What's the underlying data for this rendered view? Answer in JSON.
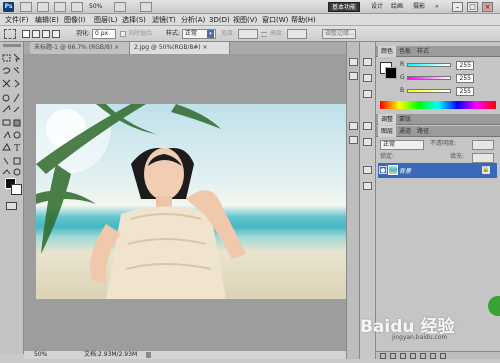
{
  "app": {
    "logo": "Ps",
    "zoom": "50%"
  },
  "workspace": {
    "active": "基本功能",
    "items": [
      "设计",
      "绘画",
      "摄影"
    ],
    "more": "»"
  },
  "window_buttons": [
    "–",
    "□",
    "×"
  ],
  "menu": [
    "文件(F)",
    "编辑(E)",
    "图像(I)",
    "图层(L)",
    "选择(S)",
    "滤镜(T)",
    "分析(A)",
    "3D(D)",
    "视图(V)",
    "窗口(W)",
    "帮助(H)"
  ],
  "options": {
    "feather_label": "羽化:",
    "feather_value": "0 px",
    "antialias_label": "消除锯齿",
    "style_label": "样式:",
    "style_value": "正常",
    "width_label": "宽度:",
    "height_label": "高度:",
    "refine_button": "调整边缘..."
  },
  "tabs": [
    {
      "label": "未标题-1 @ 66.7% (RGB/8) ×"
    },
    {
      "label": "2.jpg @ 50%(RGB/8#) ×"
    }
  ],
  "status": {
    "zoom": "50%",
    "doc": "文档:2.93M/2.93M"
  },
  "color_panel": {
    "tabs": [
      "颜色",
      "色板",
      "样式"
    ],
    "channels": [
      {
        "label": "R",
        "value": "255"
      },
      {
        "label": "G",
        "value": "255"
      },
      {
        "label": "B",
        "value": "255"
      }
    ]
  },
  "adjust_panel": {
    "tabs": [
      "调整",
      "蒙版"
    ]
  },
  "layers_panel": {
    "tabs": [
      "图层",
      "通道",
      "路径"
    ],
    "blend_mode": "正常",
    "opacity_label": "不透明度:",
    "lock_label": "锁定:",
    "fill_label": "填充:",
    "layer_name": "背景",
    "lock_icon_glyph": "🔒"
  },
  "watermark": {
    "brand": "Baidu 经验",
    "url": "jingyan.baidu.com"
  },
  "colors": {
    "accent": "#3a69b8",
    "sky": "#bfe1ea",
    "sea": "#46b7c3",
    "sand": "#dcd3b6"
  }
}
